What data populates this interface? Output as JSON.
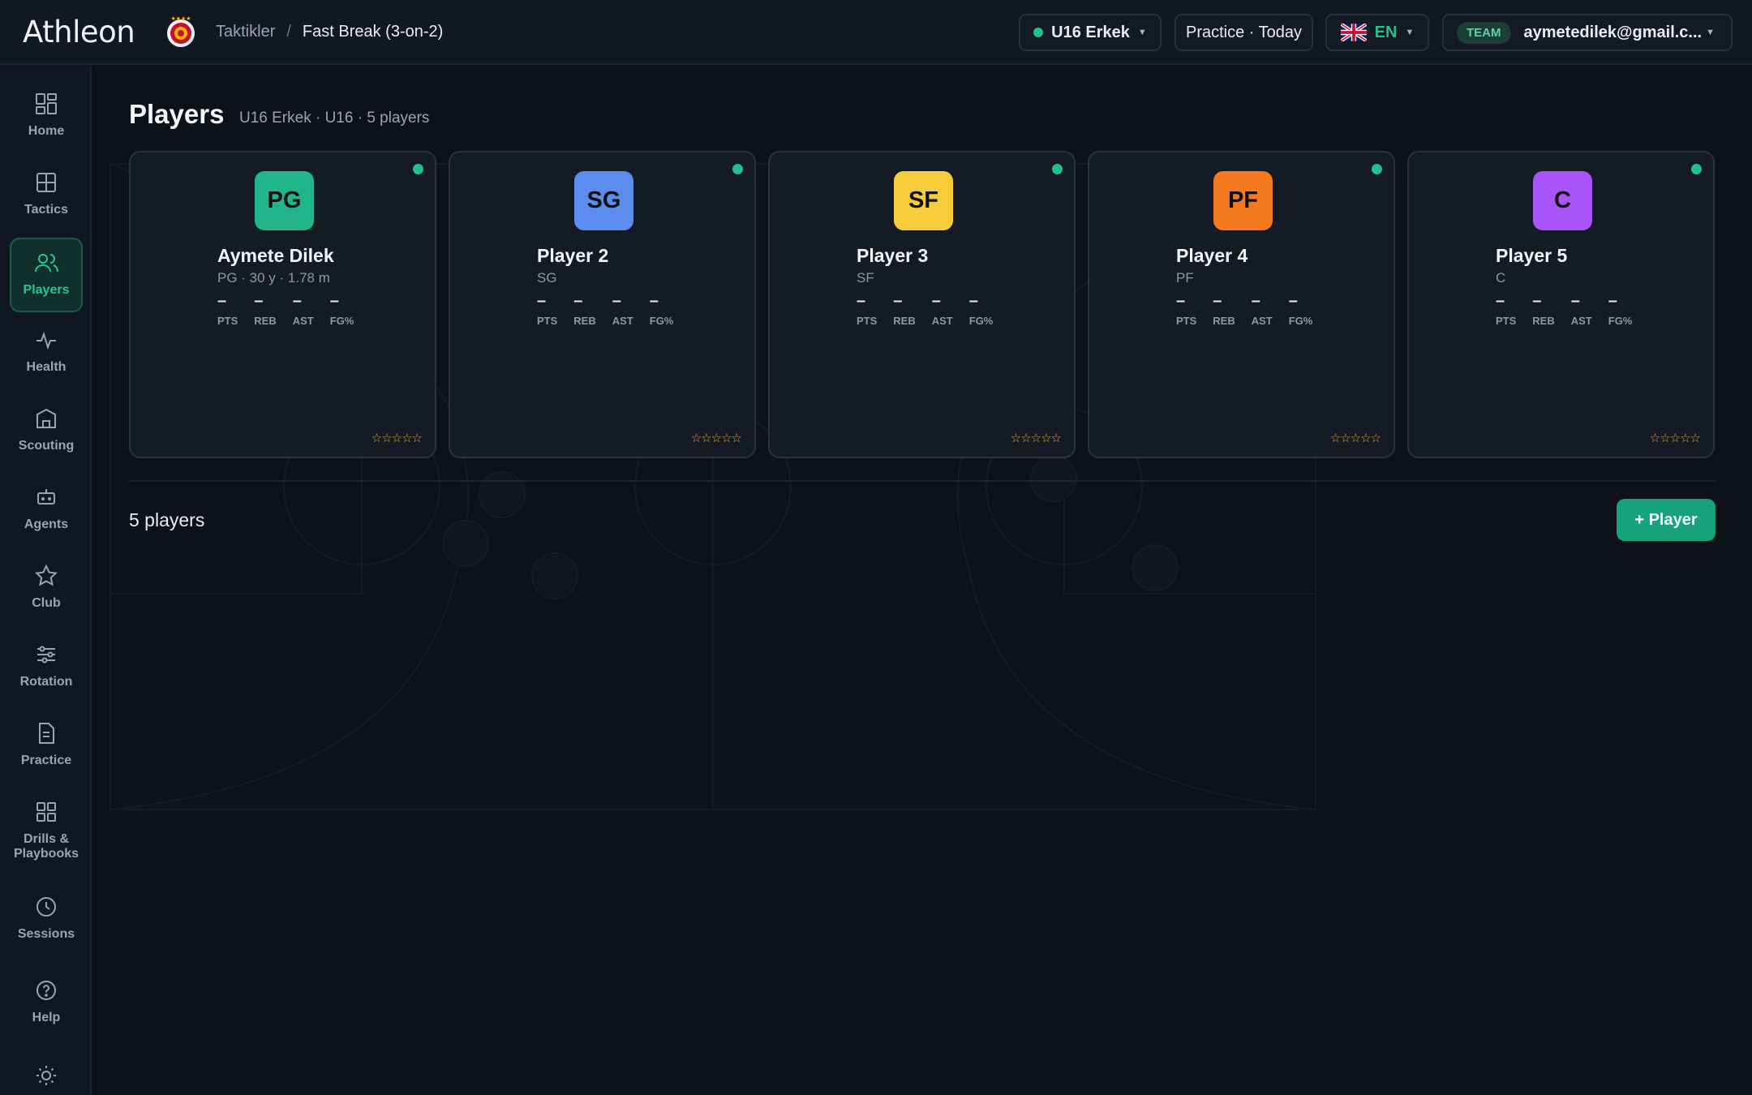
{
  "app": {
    "logo": "Athleon"
  },
  "breadcrumb": {
    "parent": "Taktikler",
    "separator": "/",
    "current": "Fast Break (3-on-2)"
  },
  "topbar": {
    "team_select": "U16 Erkek",
    "session_select": "Practice · Today",
    "language": "EN",
    "team_pill": "TEAM",
    "account": "aymetedilek@gmail.c..."
  },
  "sidebar": {
    "items": [
      {
        "label": "Home",
        "icon": "home-icon"
      },
      {
        "label": "Tactics",
        "icon": "tactics-icon"
      },
      {
        "label": "Players",
        "icon": "players-icon",
        "active": true
      },
      {
        "label": "Health",
        "icon": "health-icon"
      },
      {
        "label": "Scouting",
        "icon": "scouting-icon"
      },
      {
        "label": "Agents",
        "icon": "agents-icon"
      },
      {
        "label": "Club",
        "icon": "star-icon"
      },
      {
        "label": "Rotation",
        "icon": "sliders-icon"
      },
      {
        "label": "Practice",
        "icon": "document-icon"
      },
      {
        "label": "Drills & Playbooks",
        "icon": "grid-icon"
      },
      {
        "label": "Sessions",
        "icon": "clock-icon"
      },
      {
        "label": "Help",
        "icon": "help-icon"
      },
      {
        "label": "",
        "icon": "sun-icon"
      }
    ]
  },
  "page": {
    "title": "Players",
    "subtitle": "U16 Erkek · U16 · 5 players"
  },
  "stat_labels": [
    "PTS",
    "REB",
    "AST",
    "FG%"
  ],
  "players": [
    {
      "initials": "PG",
      "name": "Aymete Dilek",
      "meta": "PG · 30 y · 1.78 m",
      "color": "#22b58a",
      "stats": [
        "–",
        "–",
        "–",
        "–"
      ],
      "rating": "☆☆☆☆☆"
    },
    {
      "initials": "SG",
      "name": "Player 2",
      "meta": "SG",
      "color": "#5b8def",
      "stats": [
        "–",
        "–",
        "–",
        "–"
      ],
      "rating": "☆☆☆☆☆"
    },
    {
      "initials": "SF",
      "name": "Player 3",
      "meta": "SF",
      "color": "#f7cc3a",
      "stats": [
        "–",
        "–",
        "–",
        "–"
      ],
      "rating": "☆☆☆☆☆"
    },
    {
      "initials": "PF",
      "name": "Player 4",
      "meta": "PF",
      "color": "#f57a1f",
      "stats": [
        "–",
        "–",
        "–",
        "–"
      ],
      "rating": "☆☆☆☆☆"
    },
    {
      "initials": "C",
      "name": "Player 5",
      "meta": "C",
      "color": "#a855f7",
      "stats": [
        "–",
        "–",
        "–",
        "–"
      ],
      "rating": "☆☆☆☆☆"
    }
  ],
  "footer": {
    "count": "5 players",
    "add_button": "+ Player"
  },
  "colors": {
    "accent": "#22c08a",
    "background": "#0d1118",
    "star": "#e0a23a"
  }
}
